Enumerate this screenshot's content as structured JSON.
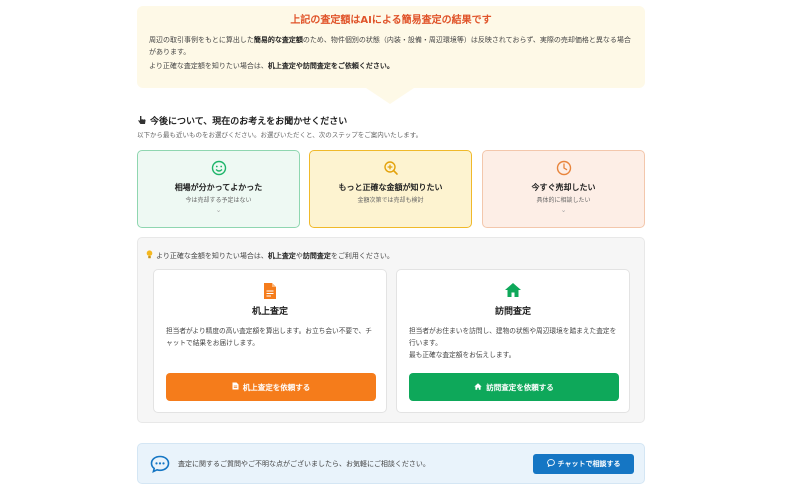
{
  "notice": {
    "title": "上記の査定額はAIによる簡易査定の結果です",
    "body_pre": "周辺の取引事例をもとに算出した",
    "body_bold": "簡易的な査定額",
    "body_post": "のため、物件個別の状態（内装・設備・周辺環境等）は反映されておらず、実際の売却価格と異なる場合があります。",
    "body2_pre": "より正確な査定額を知りたい場合は、",
    "body2_bold": "机上査定や訪問査定をご依頼ください。"
  },
  "question": {
    "icon": "pointing-hand-icon",
    "title": "今後について、現在のお考えをお聞かせください",
    "subtitle": "以下から最も近いものをお選びください。お選びいただくと、次のステップをご案内いたします。"
  },
  "options": [
    {
      "title": "相場が分かってよかった",
      "sub": "今は売却する予定はない",
      "icon": "smile-icon",
      "color": "#1eb56a"
    },
    {
      "title": "もっと正確な金額が知りたい",
      "sub": "金額次第では売却も検討",
      "icon": "zoom-in-icon",
      "color": "#e3a20c"
    },
    {
      "title": "今すぐ売却したい",
      "sub": "具体的に相談したい",
      "icon": "clock-icon",
      "color": "#e8843c"
    }
  ],
  "panel": {
    "note_pre": "より正確な金額を知りたい場合は、",
    "note_bold1": "机上査定",
    "note_mid": "や",
    "note_bold2": "訪問査定",
    "note_post": "をご利用ください。",
    "note_icon": "lightbulb-icon"
  },
  "methods": [
    {
      "title": "机上査定",
      "desc": "担当者がより精度の高い査定額を算出します。お立ち会い不要で、チャットで結果をお届けします。",
      "button": "机上査定を依頼する",
      "icon": "document-icon",
      "color": "#f57c1b"
    },
    {
      "title": "訪問査定",
      "desc": "担当者がお住まいを訪問し、建物の状態や周辺環境を踏まえた査定を行います。\n最も正確な査定額をお伝えします。",
      "button": "訪問査定を依頼する",
      "icon": "home-icon",
      "color": "#0ea85a"
    }
  ],
  "contact": {
    "text": "査定に関するご質問やご不明な点がございましたら、お気軽にご相談ください。",
    "button": "チャットで相談する",
    "icon": "chat-bubble-icon",
    "button_color": "#1576c4"
  }
}
